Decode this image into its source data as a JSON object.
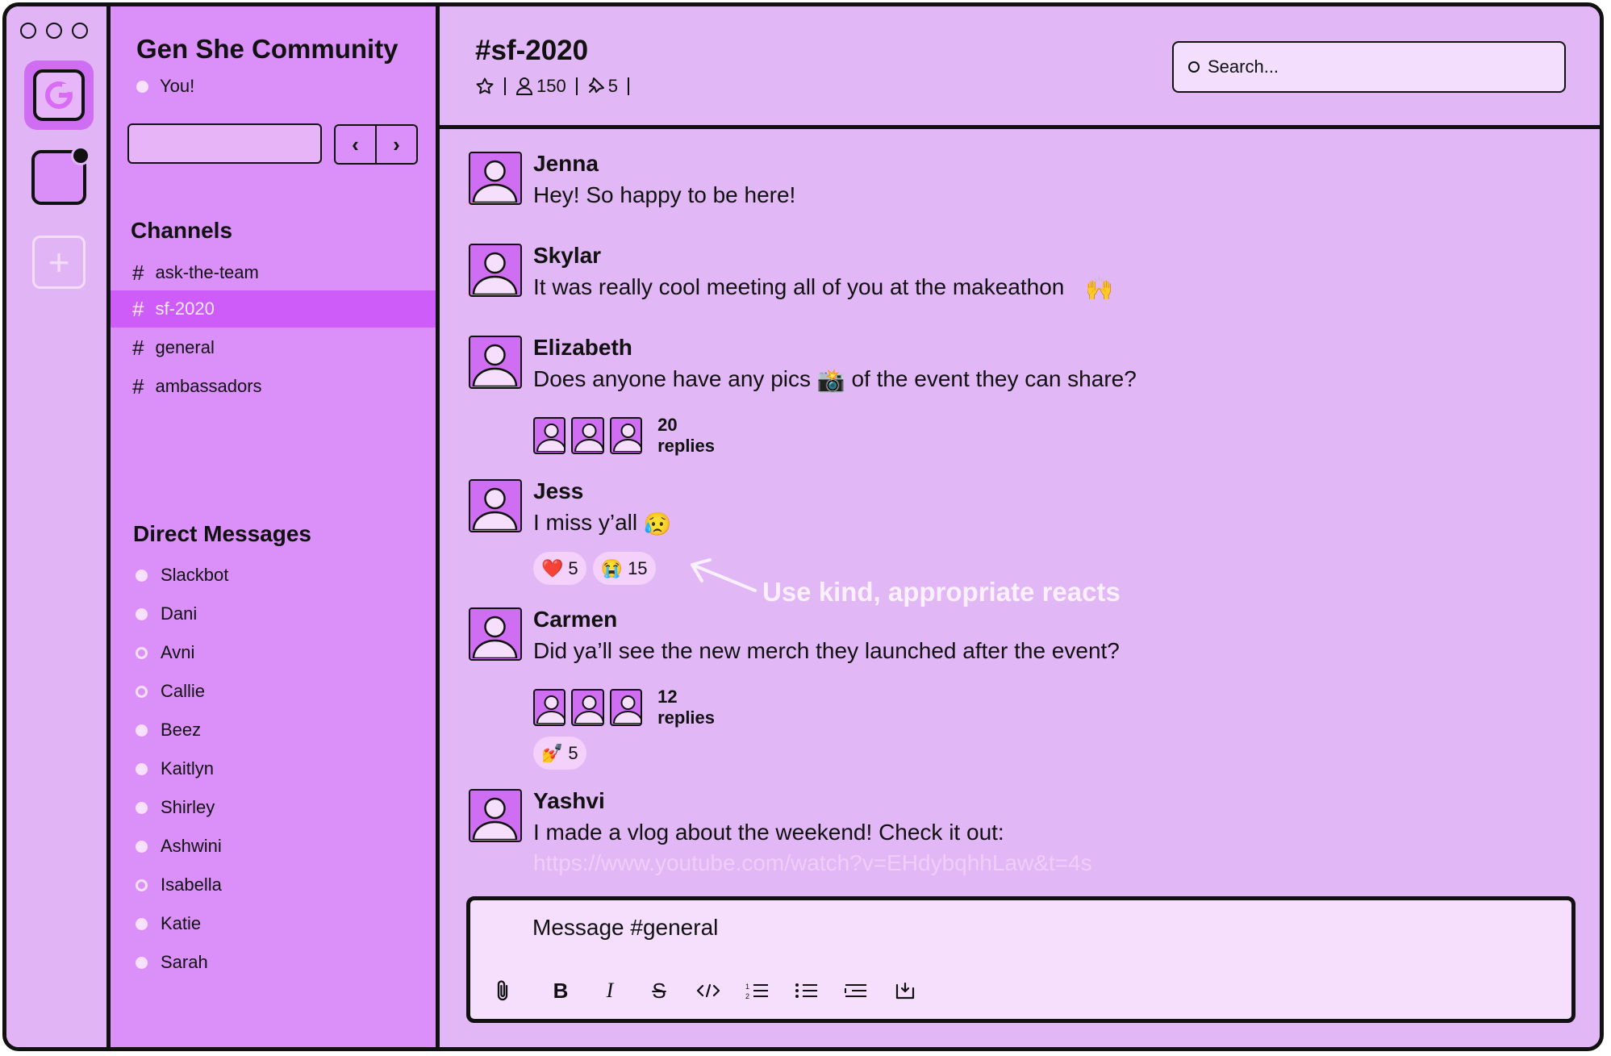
{
  "workspace": {
    "name": "Gen She Community",
    "user_status": "You!",
    "logo_letter": "G",
    "add_symbol": "+"
  },
  "navigation": {
    "back": "‹",
    "forward": "›"
  },
  "sidebar": {
    "channels_title": "Channels",
    "channels": [
      {
        "label": "ask-the-team",
        "active": false
      },
      {
        "label": "sf-2020",
        "active": true
      },
      {
        "label": "general",
        "active": false
      },
      {
        "label": "ambassadors",
        "active": false
      }
    ],
    "dm_title": "Direct Messages",
    "direct_messages": [
      {
        "name": "Slackbot",
        "status": "online"
      },
      {
        "name": "Dani",
        "status": "online"
      },
      {
        "name": "Avni",
        "status": "away"
      },
      {
        "name": "Callie",
        "status": "away"
      },
      {
        "name": "Beez",
        "status": "online"
      },
      {
        "name": "Kaitlyn",
        "status": "online"
      },
      {
        "name": "Shirley",
        "status": "online"
      },
      {
        "name": "Ashwini",
        "status": "online"
      },
      {
        "name": "Isabella",
        "status": "away"
      },
      {
        "name": "Katie",
        "status": "online"
      },
      {
        "name": "Sarah",
        "status": "online"
      }
    ]
  },
  "channel_header": {
    "title": "#sf-2020",
    "members": "150",
    "pinned": "5",
    "search_placeholder": "Search..."
  },
  "messages": [
    {
      "author": "Jenna",
      "text": "Hey! So happy to be here!"
    },
    {
      "author": "Skylar",
      "text": "It was really cool meeting all of you at the makeathon",
      "emoji": "🙌"
    },
    {
      "author": "Elizabeth",
      "text_before": "Does anyone have any  pics",
      "emoji": "📸",
      "text_after": "of the event they can share?",
      "replies": "20 replies"
    },
    {
      "author": "Jess",
      "text": "I miss y’all",
      "emoji": "😥",
      "reactions": [
        {
          "emoji": "❤️",
          "count": "5"
        },
        {
          "emoji": "😭",
          "count": "15"
        }
      ]
    },
    {
      "author": "Carmen",
      "text": "Did ya’ll see the new merch they launched after the event?",
      "replies": "12 replies",
      "reactions": [
        {
          "emoji": "💅",
          "count": "5"
        }
      ]
    },
    {
      "author": "Yashvi",
      "text": "I made a vlog about the weekend! Check it out:",
      "link": "https://www.youtube.com/watch?v=EHdybqhhLaw&t=4s"
    }
  ],
  "annotation": "Use kind, appropriate reacts",
  "composer": {
    "placeholder": "Message #general",
    "tools": [
      "attach-icon",
      "bold-icon",
      "italic-icon",
      "strikethrough-icon",
      "code-icon",
      "ordered-list-icon",
      "bullet-list-icon",
      "indent-icon",
      "shortcut-icon"
    ]
  },
  "colors": {
    "rail": "#e1b5f5",
    "sidebar": "#da8ff9",
    "active_channel": "#cd5cf9",
    "main": "#e2b7f6",
    "avatar": "#cf6df3",
    "input": "#f5dffd"
  }
}
